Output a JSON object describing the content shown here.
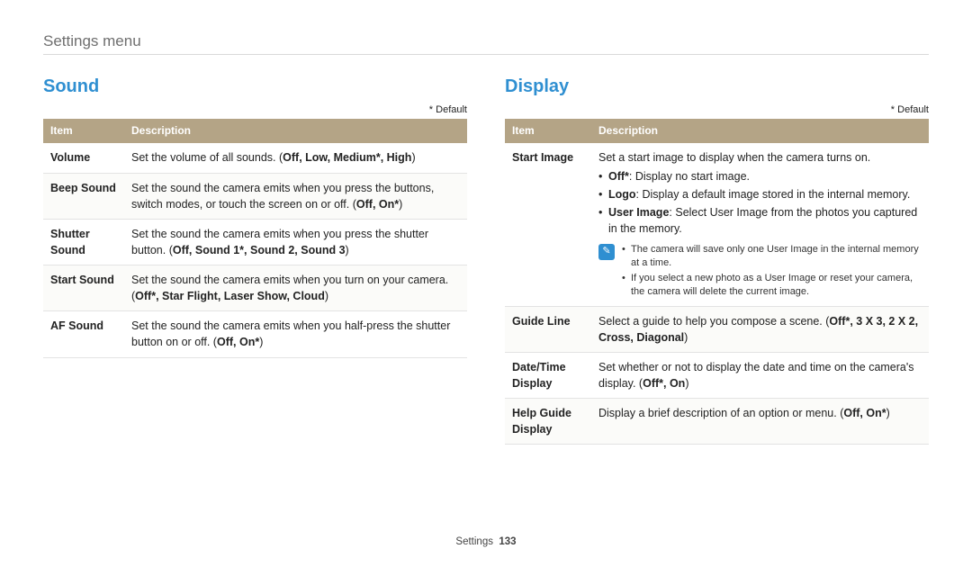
{
  "page": {
    "title": "Settings menu",
    "footer_label": "Settings",
    "footer_page": "133"
  },
  "default_marker": "* Default",
  "note_icon_glyph": "✎",
  "sound": {
    "heading": "Sound",
    "cols": {
      "item": "Item",
      "desc": "Description"
    },
    "rows": {
      "volume": {
        "item": "Volume",
        "pre": "Set the volume of all sounds. (",
        "opts": "Off, Low, Medium*, High",
        "post": ")"
      },
      "beep": {
        "item": "Beep Sound",
        "pre": "Set the sound the camera emits when you press the buttons, switch modes, or touch the screen on or off. (",
        "opts": "Off, On*",
        "post": ")"
      },
      "shutter": {
        "item": "Shutter Sound",
        "pre": "Set the sound the camera emits when you press the shutter button. (",
        "opts": "Off, Sound 1*, Sound 2, Sound 3",
        "post": ")"
      },
      "start": {
        "item": "Start Sound",
        "pre": "Set the sound the camera emits when you turn on your camera. (",
        "opts": "Off*, Star Flight, Laser Show, Cloud",
        "post": ")"
      },
      "af": {
        "item": "AF Sound",
        "pre": "Set the sound the camera emits when you half-press the shutter button on or off. (",
        "opts": "Off, On*",
        "post": ")"
      }
    }
  },
  "display": {
    "heading": "Display",
    "cols": {
      "item": "Item",
      "desc": "Description"
    },
    "rows": {
      "startimg": {
        "item": "Start Image",
        "intro": "Set a start image to display when the camera turns on.",
        "bullets": {
          "off": {
            "label": "Off*",
            "text": ": Display no start image."
          },
          "logo": {
            "label": "Logo",
            "text": ": Display a default image stored in the internal memory."
          },
          "user": {
            "label": "User Image",
            "text": ": Select User Image from the photos you captured in the memory."
          }
        },
        "notes": {
          "n1": "The camera will save only one User Image in the internal memory at a time.",
          "n2": "If you select a new photo as a User Image or reset your camera, the camera will delete the current image."
        }
      },
      "guideline": {
        "item": "Guide Line",
        "pre": "Select a guide to help you compose a scene. (",
        "opts": "Off*, 3 X 3, 2 X 2, Cross, Diagonal",
        "post": ")"
      },
      "datetime": {
        "item": "Date/Time Display",
        "pre": "Set whether or not to display the date and time on the camera's display. (",
        "opts": "Off*, On",
        "post": ")"
      },
      "helpguide": {
        "item": "Help Guide Display",
        "pre": "Display a brief description of an option or menu. (",
        "opts": "Off, On*",
        "post": ")"
      }
    }
  }
}
